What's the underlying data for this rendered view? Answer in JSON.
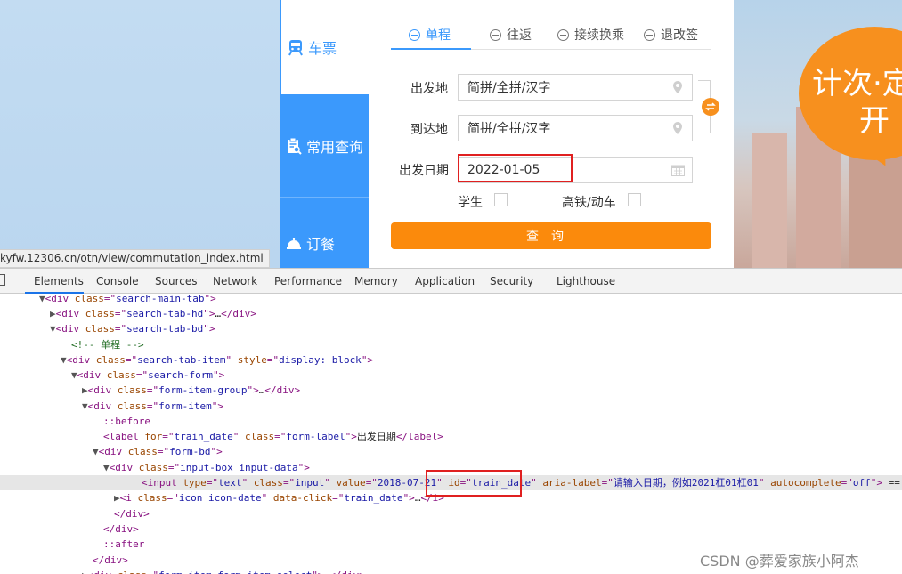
{
  "page": {
    "status_url": "kyfw.12306.cn/otn/view/commutation_index.html",
    "banner": {
      "line1": "计次·定",
      "line2": "开"
    }
  },
  "menu": {
    "items": [
      {
        "label": "车票",
        "icon": "train-icon"
      },
      {
        "label": "常用查询",
        "icon": "clipboard-search-icon"
      },
      {
        "label": "订餐",
        "icon": "meal-icon"
      }
    ]
  },
  "form": {
    "tabs": [
      {
        "label": "单程",
        "icon": "minus-circle-icon"
      },
      {
        "label": "往返",
        "icon": "equals-circle-icon"
      },
      {
        "label": "接续换乘",
        "icon": "refresh-circle-icon"
      },
      {
        "label": "退改签",
        "icon": "list-circle-icon"
      }
    ],
    "from_label": "出发地",
    "from_value": "简拼/全拼/汉字",
    "to_label": "到达地",
    "to_value": "简拼/全拼/汉字",
    "date_label": "出发日期",
    "date_value": "2022-01-05",
    "student_label": "学生",
    "gaotie_label": "高铁/动车",
    "query_label": "查询"
  },
  "devtools": {
    "tabs": [
      "Elements",
      "Console",
      "Sources",
      "Network",
      "Performance",
      "Memory",
      "Application",
      "Security",
      "Lighthouse"
    ],
    "active_tab": "Elements"
  },
  "colors": {
    "accent_blue": "#3b99fc",
    "accent_orange": "#fb8a0c",
    "highlight_red": "#e02020"
  },
  "watermark": "CSDN @葬爱家族小阿杰"
}
